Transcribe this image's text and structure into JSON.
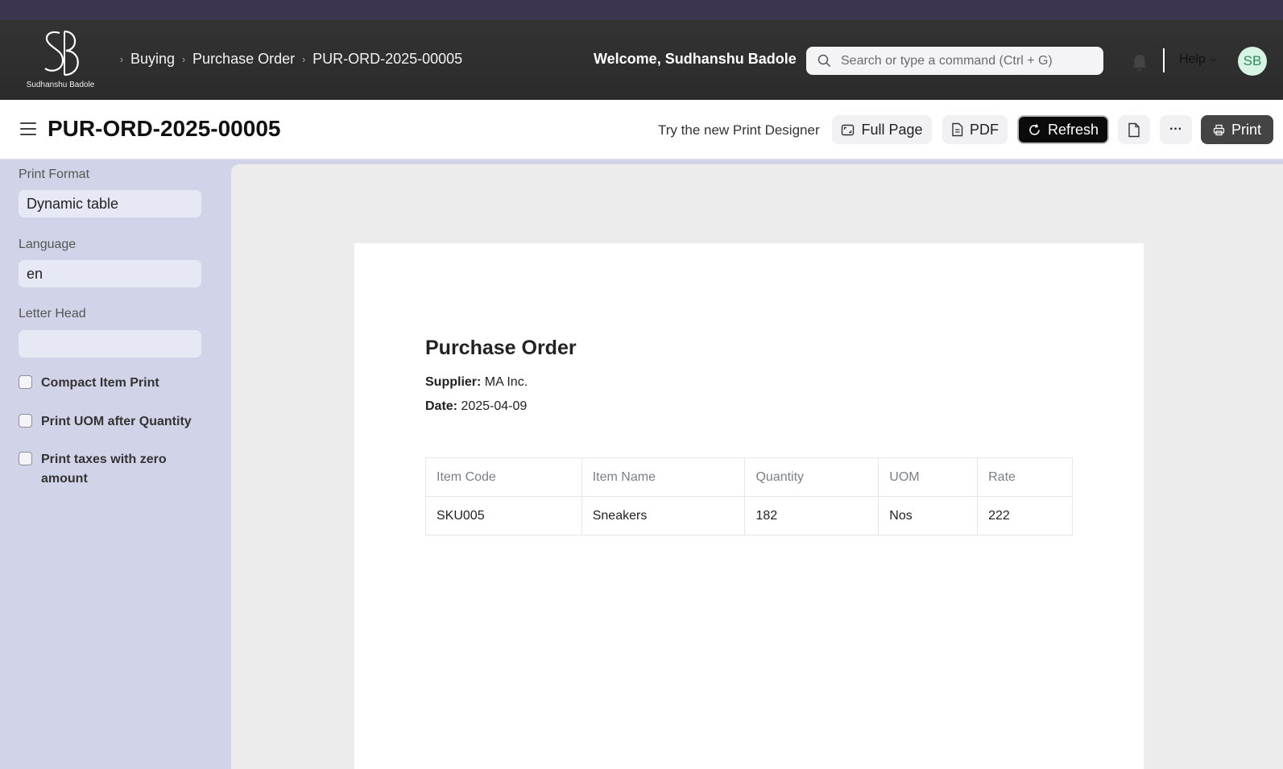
{
  "brand": {
    "logo_monogram": "SB",
    "logo_caption": "Sudhanshu Badole"
  },
  "breadcrumbs": [
    {
      "label": "Buying"
    },
    {
      "label": "Purchase Order"
    },
    {
      "label": "PUR-ORD-2025-00005"
    }
  ],
  "navbar": {
    "welcome": "Welcome, Sudhanshu Badole",
    "search_placeholder": "Search or type a command (Ctrl + G)",
    "help_label": "Help",
    "avatar_initials": "SB",
    "icons": {
      "search": "search-icon",
      "notifications": "bell-icon",
      "help_dropdown": "chevron-down-icon"
    }
  },
  "page": {
    "title": "PUR-ORD-2025-00005",
    "try_designer": "Try the new Print Designer",
    "actions": {
      "full_page": "Full Page",
      "pdf": "PDF",
      "refresh": "Refresh",
      "more": "···",
      "print": "Print"
    }
  },
  "sidebar": {
    "print_format_label": "Print Format",
    "print_format_value": "Dynamic table",
    "language_label": "Language",
    "language_value": "en",
    "letter_head_label": "Letter Head",
    "letter_head_value": "",
    "checkboxes": [
      {
        "label": "Compact Item Print",
        "checked": false
      },
      {
        "label": "Print UOM after Quantity",
        "checked": false
      },
      {
        "label": "Print taxes with zero amount",
        "checked": false
      }
    ]
  },
  "document": {
    "title": "Purchase Order",
    "supplier_label": "Supplier:",
    "supplier_value": "MA Inc.",
    "date_label": "Date:",
    "date_value": "2025-04-09",
    "table": {
      "headers": [
        "Item Code",
        "Item Name",
        "Quantity",
        "UOM",
        "Rate"
      ],
      "rows": [
        [
          "SKU005",
          "Sneakers",
          "182",
          "Nos",
          "222"
        ]
      ]
    }
  },
  "colors": {
    "navbar": "#2b2b2b",
    "topstrip": "#3b3550",
    "sidebar": "#d1d3e8",
    "preview_bg": "#ececec",
    "refresh_button": "#0b0b0b",
    "avatar_bg": "#d7f3e3"
  }
}
